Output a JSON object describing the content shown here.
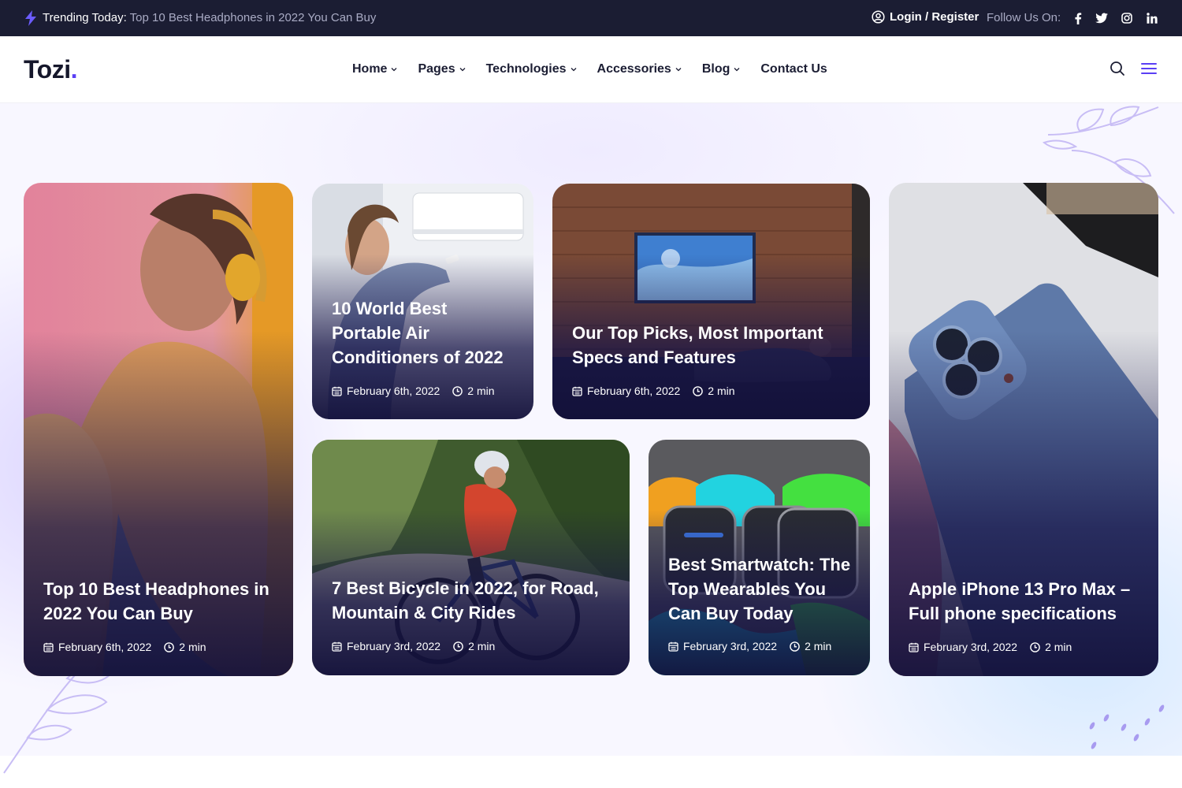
{
  "topbar": {
    "trending_label": "Trending Today:",
    "trending_text": "Top 10 Best Headphones in 2022 You Can Buy",
    "login_label": "Login / Register",
    "follow_label": "Follow Us On:",
    "social_icons": [
      "facebook-icon",
      "twitter-icon",
      "instagram-icon",
      "linkedin-icon"
    ]
  },
  "header": {
    "logo_text": "Tozi",
    "logo_dot": ".",
    "nav": [
      {
        "label": "Home",
        "has_dropdown": true
      },
      {
        "label": "Pages",
        "has_dropdown": true
      },
      {
        "label": "Technologies",
        "has_dropdown": true
      },
      {
        "label": "Accessories",
        "has_dropdown": true
      },
      {
        "label": "Blog",
        "has_dropdown": true
      },
      {
        "label": "Contact Us",
        "has_dropdown": false
      }
    ]
  },
  "colors": {
    "accent": "#5a3ff5",
    "topbar_bg": "#1b1d33",
    "muted_text": "#a9abc4"
  },
  "cards": [
    {
      "title": "Top 10 Best Headphones in 2022 You Can Buy",
      "date": "February 6th, 2022",
      "read_time": "2 min"
    },
    {
      "title": "10 World Best Portable Air Conditioners of 2022",
      "date": "February 6th, 2022",
      "read_time": "2 min"
    },
    {
      "title": "Our Top Picks, Most Important Specs and Features",
      "date": "February 6th, 2022",
      "read_time": "2 min"
    },
    {
      "title": "Apple iPhone 13 Pro Max – Full phone specifications",
      "date": "February 3rd, 2022",
      "read_time": "2 min"
    },
    {
      "title": "7 Best Bicycle in 2022, for Road, Mountain & City Rides",
      "date": "February 3rd, 2022",
      "read_time": "2 min"
    },
    {
      "title": "Best Smartwatch: The Top Wearables You Can Buy Today",
      "date": "February 3rd, 2022",
      "read_time": "2 min"
    }
  ]
}
